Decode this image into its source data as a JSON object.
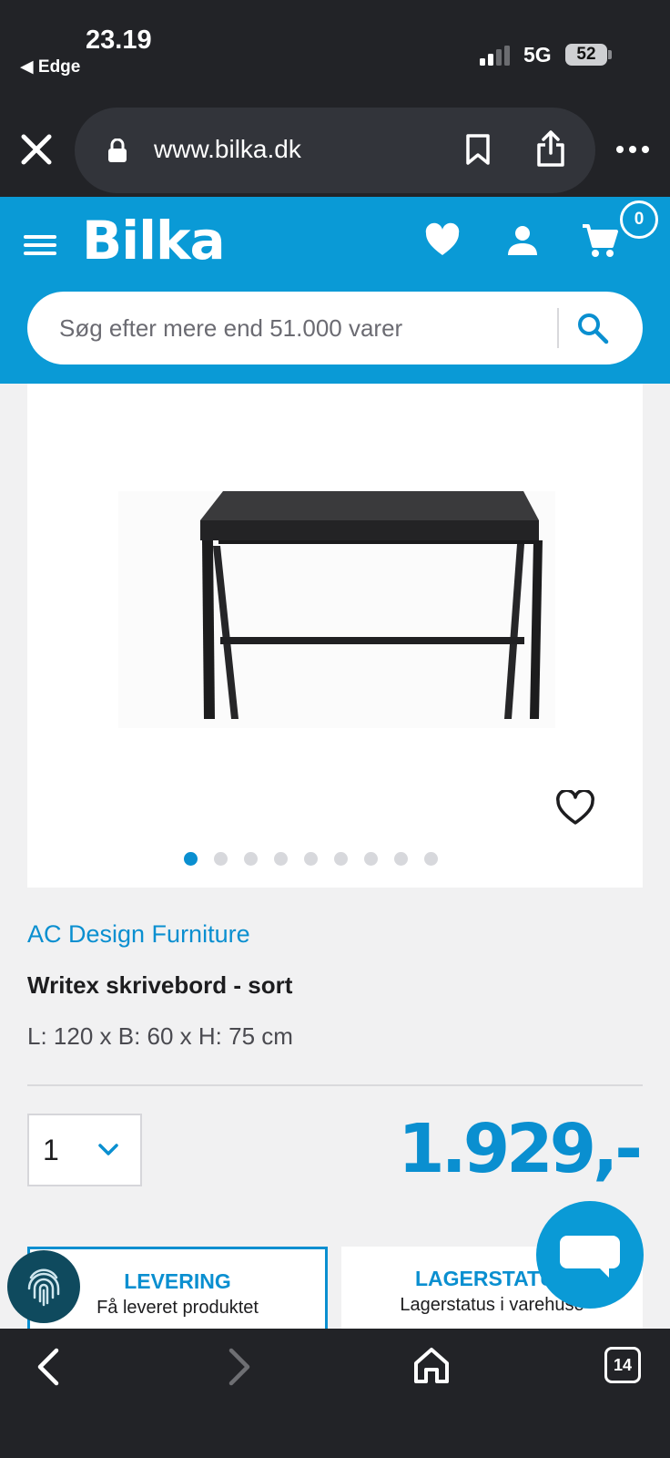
{
  "status_bar": {
    "time": "23.19",
    "back_app": "◀ Edge",
    "network": "5G",
    "battery": "52"
  },
  "browser": {
    "url": "www.bilka.dk",
    "tab_count": "14"
  },
  "header": {
    "logo": "Bilka",
    "cart_count": "0",
    "search_placeholder": "Søg efter mere end 51.000 varer"
  },
  "gallery": {
    "image_count": 9,
    "active_index": 0
  },
  "product": {
    "brand": "AC Design Furniture",
    "title": "Writex skrivebord - sort",
    "dimensions": "L: 120 x B: 60 x H: 75 cm",
    "quantity": "1",
    "price": "1.929,-"
  },
  "tabs": [
    {
      "title": "LEVERING",
      "subtitle": "Få leveret produktet"
    },
    {
      "title": "LAGERSTATUS",
      "subtitle": "Lagerstatus i varehuse"
    }
  ],
  "colors": {
    "brand_blue": "#0a9ad6",
    "price_blue": "#0a8fd0",
    "chrome_dark": "#222327"
  },
  "icons": [
    "close-icon",
    "lock-icon",
    "bookmark-icon",
    "share-icon",
    "more-icon",
    "menu-icon",
    "heart-icon",
    "user-icon",
    "cart-icon",
    "search-icon",
    "chevron-down-icon",
    "fingerprint-icon",
    "chat-icon",
    "back-icon",
    "forward-icon",
    "home-icon"
  ]
}
